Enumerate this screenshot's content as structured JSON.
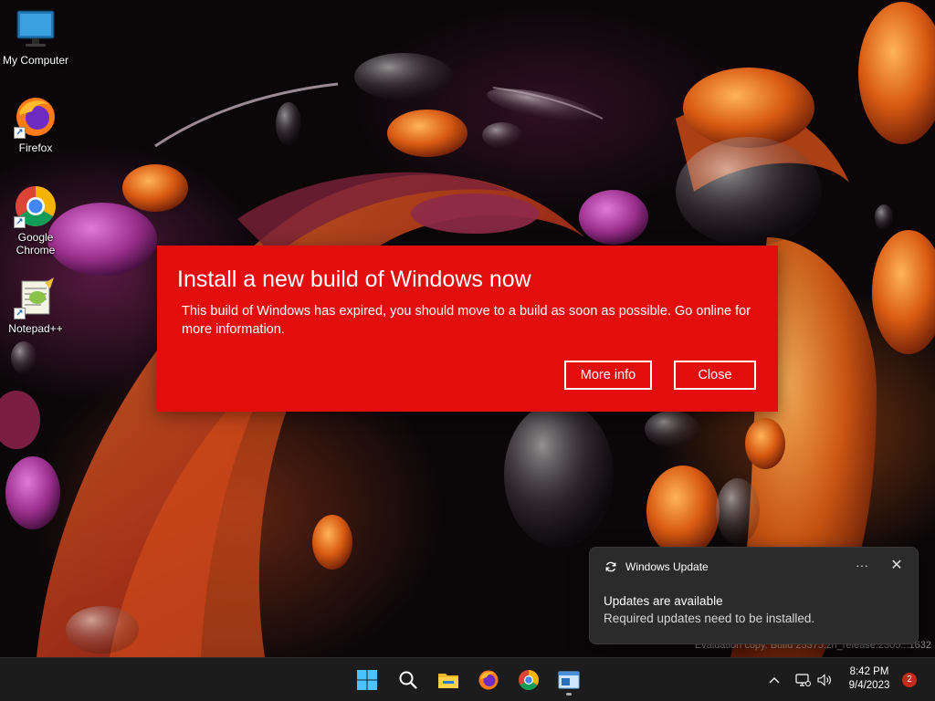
{
  "desktop": {
    "icons": [
      {
        "label": "My Computer"
      },
      {
        "label": "Firefox"
      },
      {
        "label": "Google Chrome"
      },
      {
        "label": "Notepad++"
      }
    ]
  },
  "expiry_banner": {
    "title": "Install a new build of Windows now",
    "message": "This build of Windows has expired, you should move to a build as soon as possible. Go online for more information.",
    "more_info_label": "More info",
    "close_label": "Close",
    "background_color": "#e20d0d"
  },
  "watermark": {
    "line": "Evaluation copy. Build 25375.zn_release.2305...1632"
  },
  "toast": {
    "app_name": "Windows Update",
    "more_label": "···",
    "close_label": "✕",
    "title": "Updates are available",
    "body": "Required updates need to be installed."
  },
  "taskbar": {
    "apps": [
      {
        "icon": "windows-start-icon"
      },
      {
        "icon": "search-icon"
      },
      {
        "icon": "file-explorer-icon"
      },
      {
        "icon": "firefox-icon"
      },
      {
        "icon": "chrome-icon"
      },
      {
        "icon": "active-app-icon"
      }
    ],
    "tray": {
      "time": "8:42 PM",
      "date": "9/4/2023",
      "notification_count": "2"
    }
  }
}
